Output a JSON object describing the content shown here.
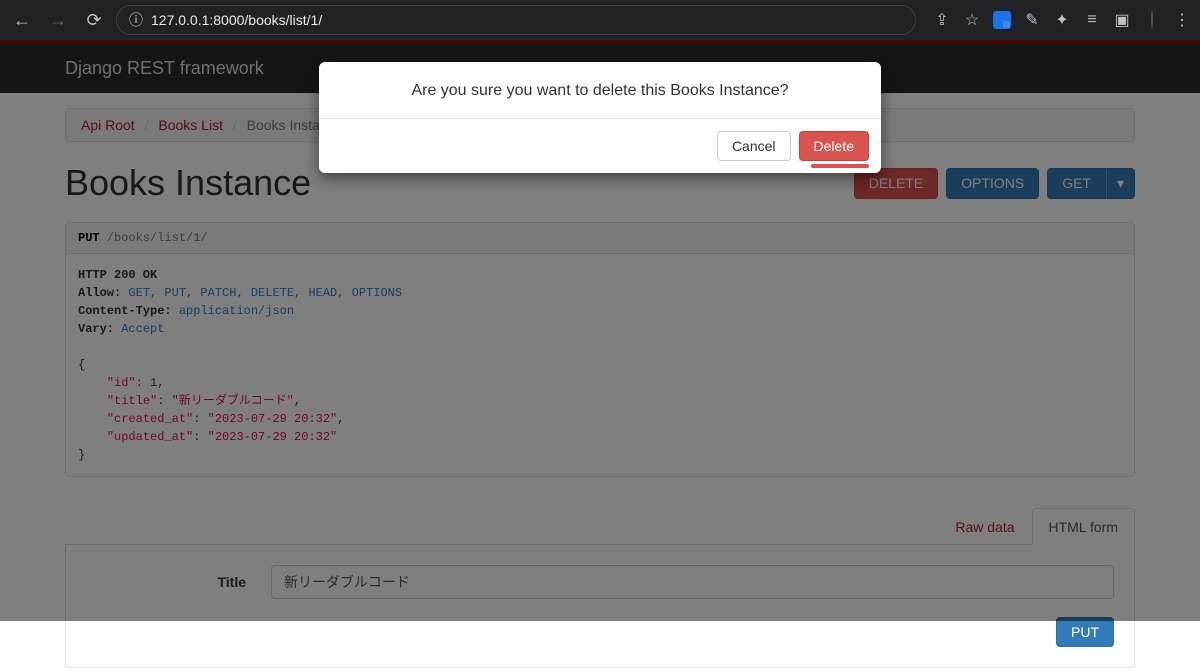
{
  "browser": {
    "url": "127.0.0.1:8000/books/list/1/"
  },
  "nav": {
    "brand": "Django REST framework"
  },
  "breadcrumb": {
    "root": "Api Root",
    "list": "Books List",
    "current": "Books Instance"
  },
  "page": {
    "title": "Books Instance"
  },
  "action_buttons": {
    "delete": "DELETE",
    "options": "OPTIONS",
    "get": "GET"
  },
  "request": {
    "method": "PUT",
    "path": "/books/list/1/"
  },
  "response": {
    "status_line": "HTTP 200 OK",
    "headers": {
      "allow_key": "Allow:",
      "allow_val": "GET, PUT, PATCH, DELETE, HEAD, OPTIONS",
      "ctype_key": "Content-Type:",
      "ctype_val": "application/json",
      "vary_key": "Vary:",
      "vary_val": "Accept"
    },
    "json": {
      "id_key": "\"id\"",
      "id_val": "1",
      "title_key": "\"title\"",
      "title_val": "\"新リーダブルコード\"",
      "created_key": "\"created_at\"",
      "created_val": "\"2023-07-29 20:32\"",
      "updated_key": "\"updated_at\"",
      "updated_val": "\"2023-07-29 20:32\""
    }
  },
  "tabs": {
    "raw": "Raw data",
    "html": "HTML form"
  },
  "form": {
    "title_label": "Title",
    "title_value": "新リーダブルコード",
    "submit": "PUT"
  },
  "modal": {
    "message": "Are you sure you want to delete this Books Instance?",
    "cancel": "Cancel",
    "delete": "Delete"
  }
}
